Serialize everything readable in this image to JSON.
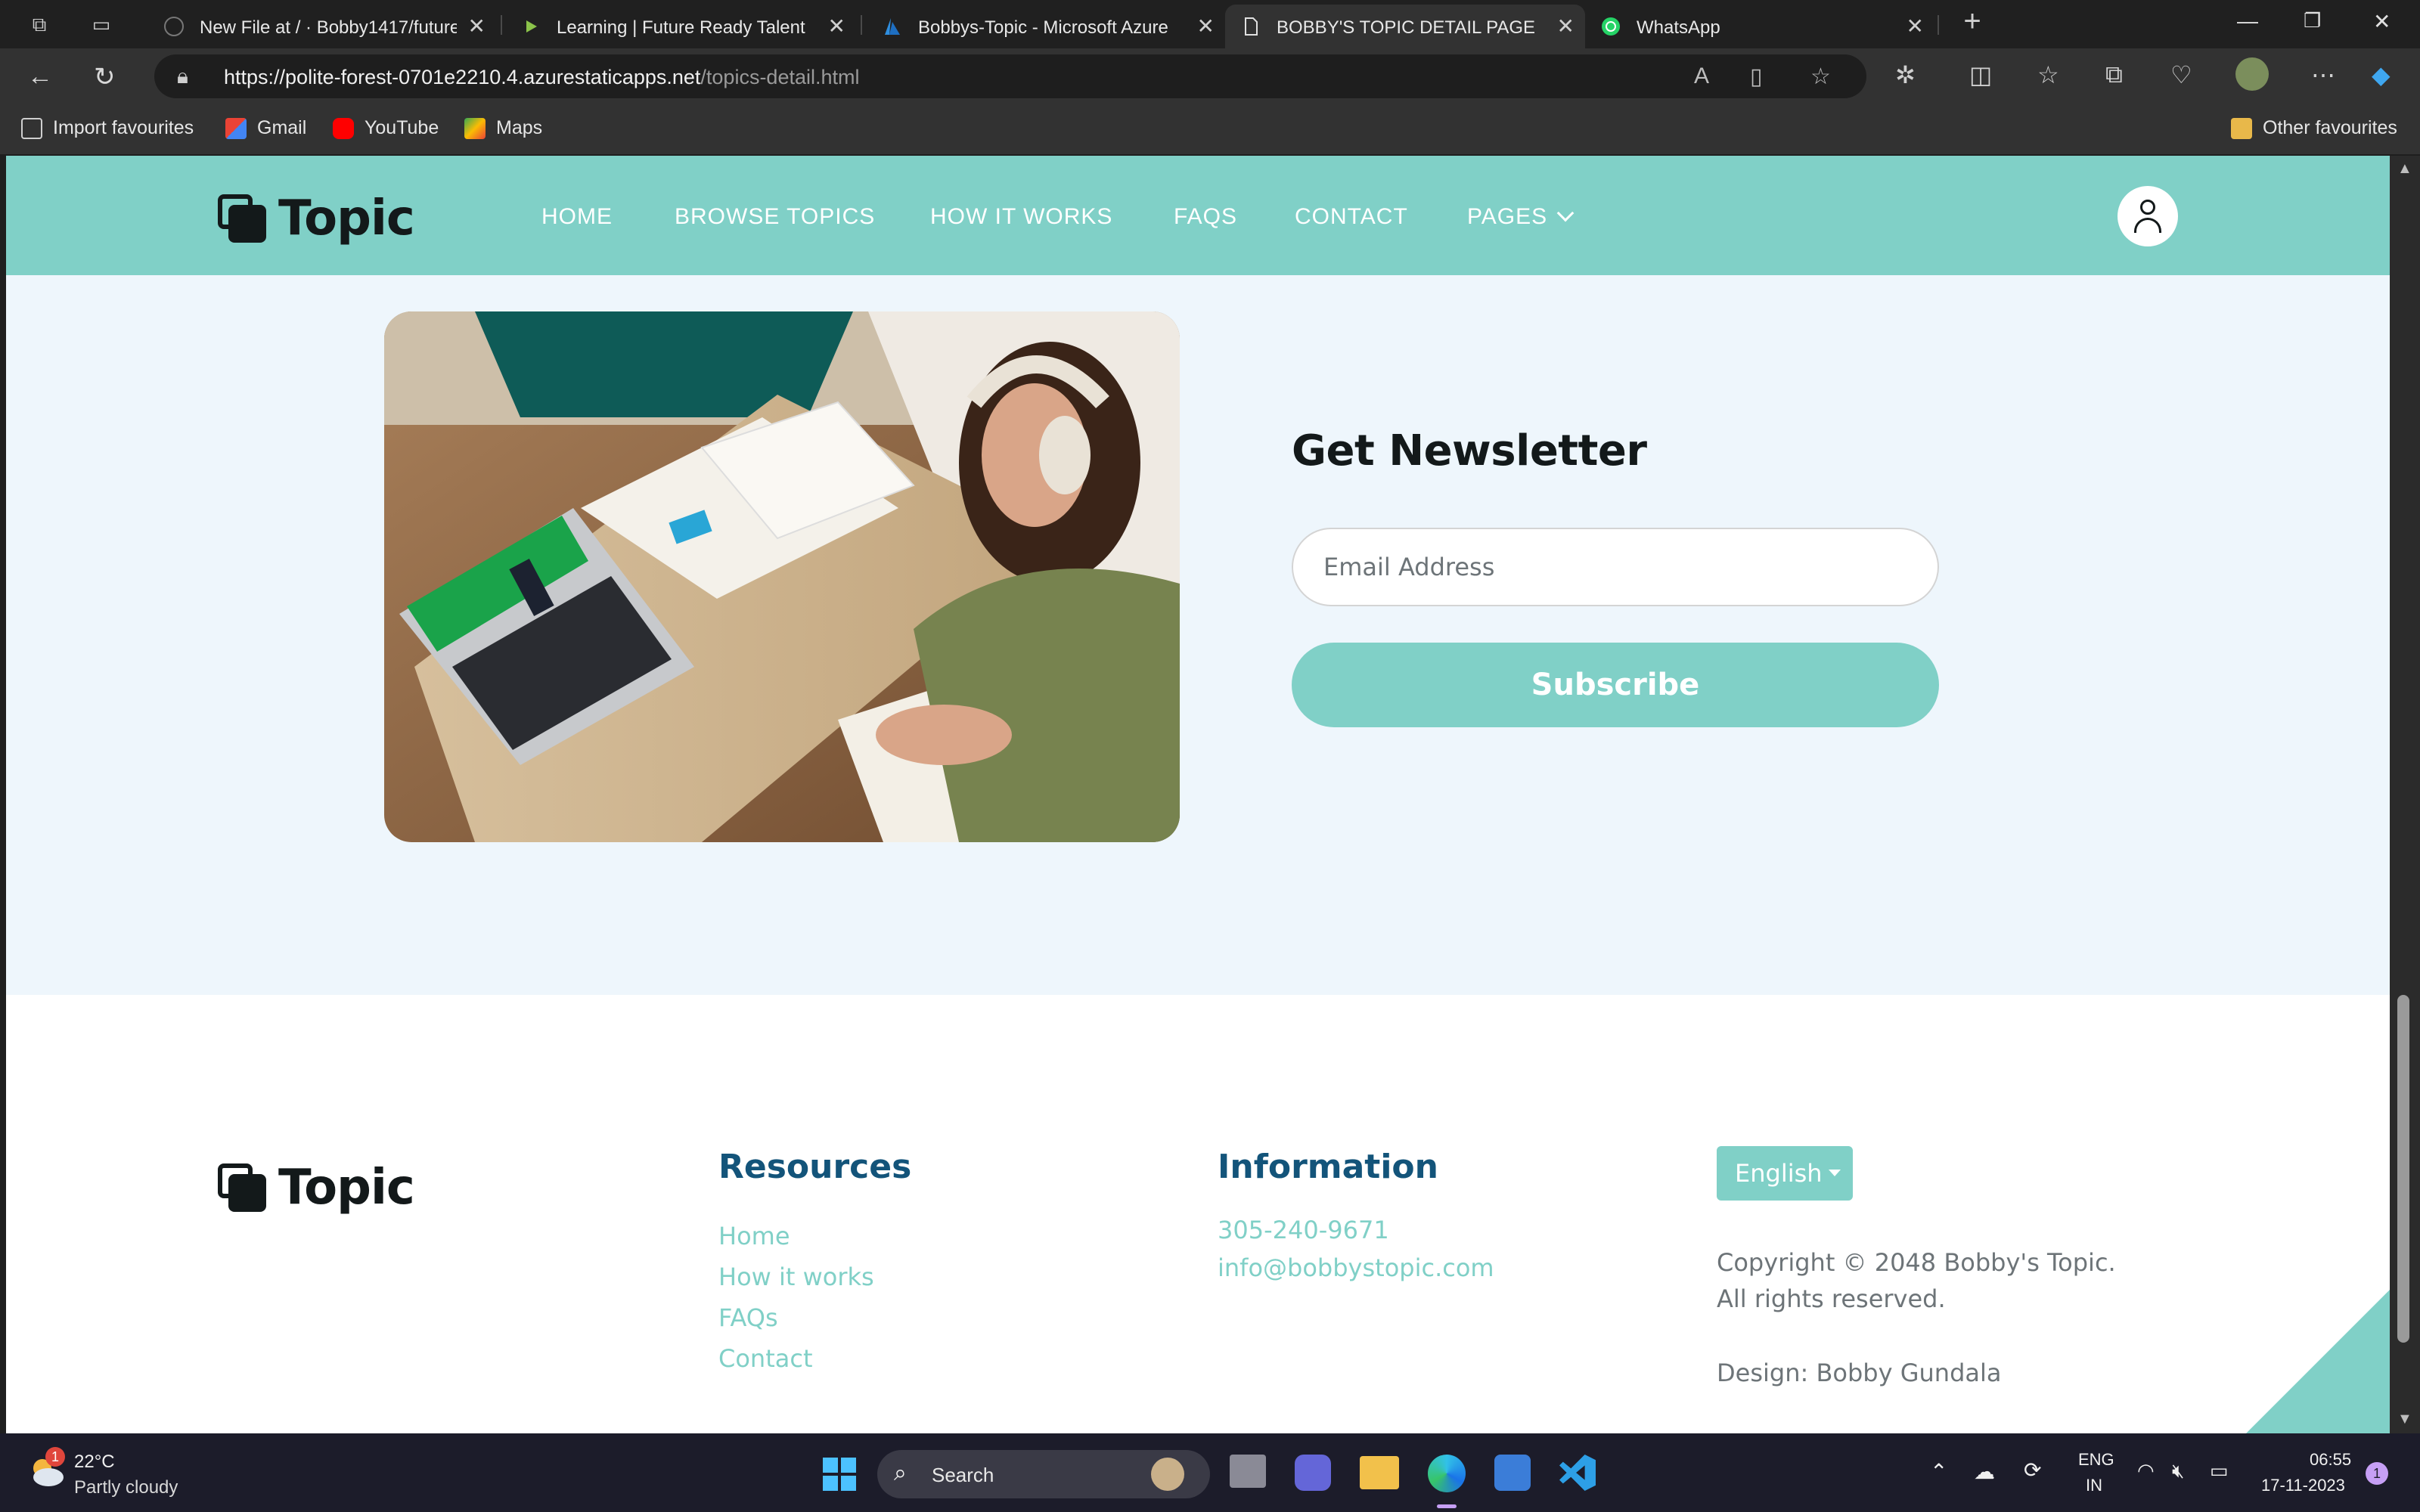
{
  "browser": {
    "tabs": [
      {
        "title": "New File at / · Bobby1417/future",
        "close": "✕"
      },
      {
        "title": "Learning | Future Ready Talent",
        "close": "✕"
      },
      {
        "title": "Bobbys-Topic - Microsoft Azure",
        "close": "✕"
      },
      {
        "title": "BOBBY'S TOPIC DETAIL PAGE",
        "close": "✕"
      },
      {
        "title": "WhatsApp",
        "close": "✕"
      }
    ],
    "new_tab": "+",
    "url_host": "https://polite-forest-0701e2210.4.azurestaticapps.net",
    "url_path": "/topics-detail.html",
    "favourites": [
      "Import favourites",
      "Gmail",
      "YouTube",
      "Maps"
    ],
    "other_favourites": "Other favourites"
  },
  "site": {
    "logo": "Topic",
    "nav": [
      "HOME",
      "BROWSE TOPICS",
      "HOW IT WORKS",
      "FAQS",
      "CONTACT",
      "PAGES"
    ],
    "newsletter": {
      "title": "Get Newsletter",
      "email_placeholder": "Email Address",
      "subscribe": "Subscribe"
    },
    "footer": {
      "logo": "Topic",
      "resources_title": "Resources",
      "resources": [
        "Home",
        "How it works",
        "FAQs",
        "Contact"
      ],
      "information_title": "Information",
      "phone": "305-240-9671",
      "email": "info@bobbystopic.com",
      "language": "English",
      "copyright": "Copyright © 2048 Bobby's Topic. All rights reserved.",
      "design": "Design: Bobby Gundala"
    }
  },
  "taskbar": {
    "weather_temp": "22°C",
    "weather_desc": "Partly cloudy",
    "weather_badge": "1",
    "search": "Search",
    "lang_top": "ENG",
    "lang_bottom": "IN",
    "time": "06:55",
    "date": "17-11-2023",
    "notif_count": "1"
  },
  "colors": {
    "accent": "#80d0c7",
    "heading_blue": "#13547a",
    "page_bg": "#eef6fc"
  }
}
